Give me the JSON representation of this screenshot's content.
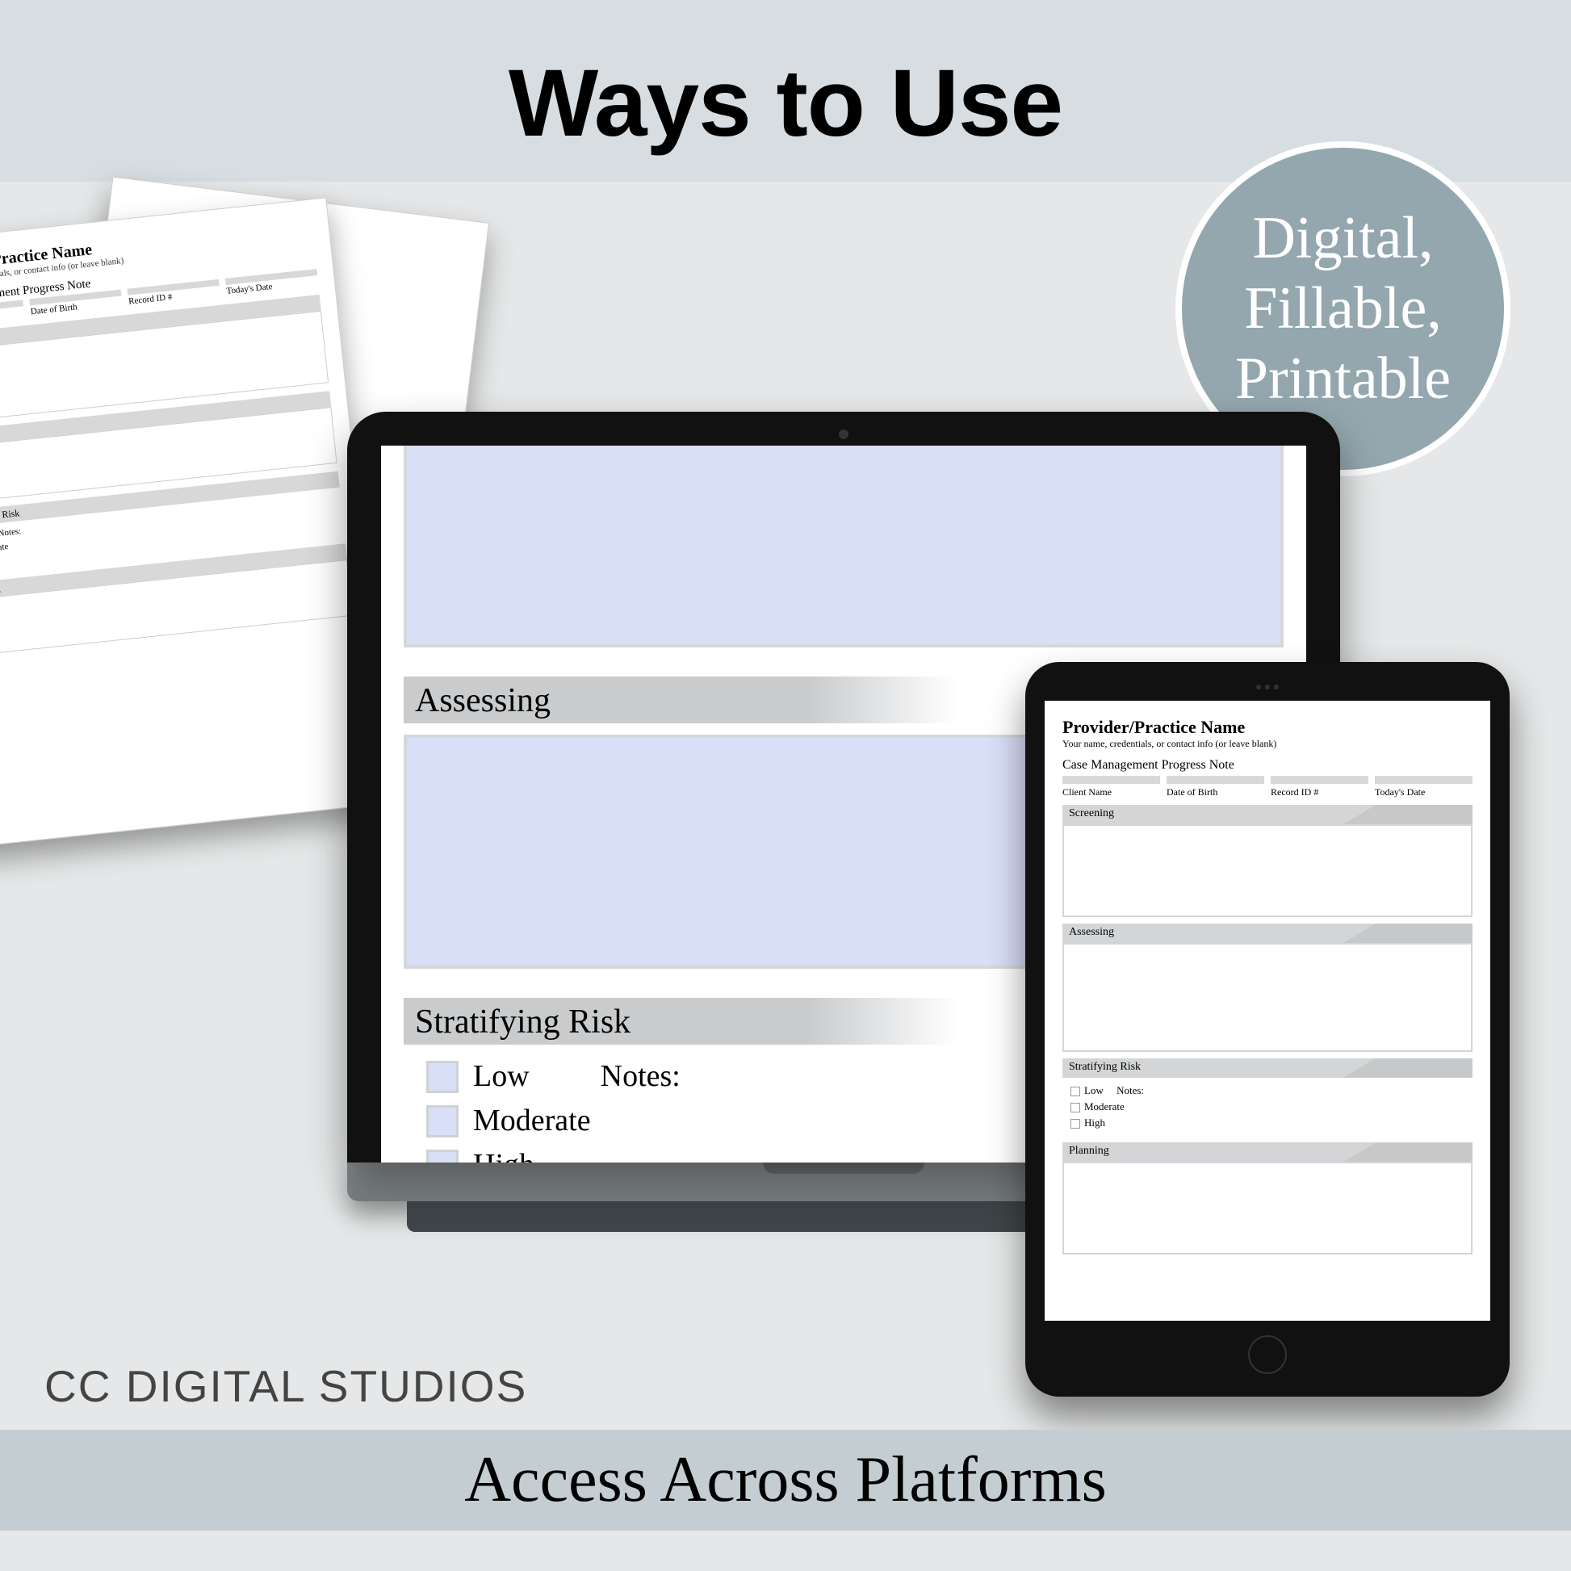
{
  "header": {
    "title": "Ways to Use"
  },
  "badge": {
    "line1": "Digital,",
    "line2": "Fillable,",
    "line3": "Printable"
  },
  "form": {
    "providerName": "Provider/Practice Name",
    "providerSub": "Your name, credentials, or contact info (or leave blank)",
    "formTitle": "Case Management Progress Note",
    "fields": {
      "client": "Client Name",
      "dob": "Date of Birth",
      "record": "Record ID #",
      "date": "Today's Date"
    },
    "sections": {
      "screening": "Screening",
      "assessing": "Assessing",
      "stratifying": "Stratifying Risk",
      "planning": "Planning"
    },
    "risk": {
      "low": "Low",
      "moderate": "Moderate",
      "high": "High",
      "notes": "Notes:"
    }
  },
  "brand": "CC DIGITAL STUDIOS",
  "footer": "Access Across Platforms"
}
